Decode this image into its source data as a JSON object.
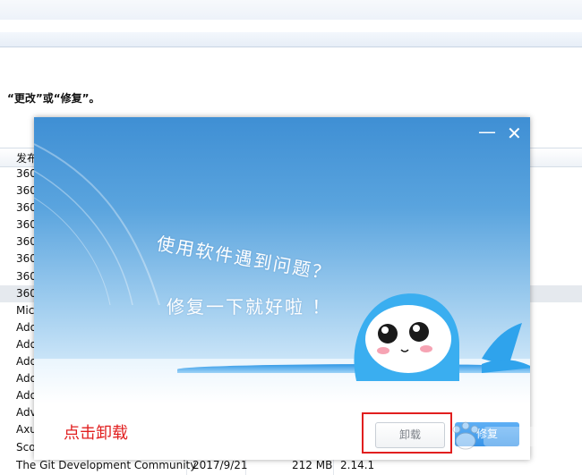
{
  "background": {
    "hint_text": "“更改”或“修复”。",
    "list_header_first_col": "发布",
    "rows": [
      {
        "publisher": "360"
      },
      {
        "publisher": "360"
      },
      {
        "publisher": "360"
      },
      {
        "publisher": "360"
      },
      {
        "publisher": "360"
      },
      {
        "publisher": "360"
      },
      {
        "publisher": "360"
      },
      {
        "publisher": "360",
        "selected": true
      },
      {
        "publisher": "Mic"
      },
      {
        "publisher": "Ado"
      },
      {
        "publisher": "Ado"
      },
      {
        "publisher": "Ado"
      },
      {
        "publisher": "Ado"
      },
      {
        "publisher": "Ado"
      },
      {
        "publisher": "Adv"
      },
      {
        "publisher": "Axu"
      },
      {
        "publisher": "Sco"
      }
    ],
    "last_row": {
      "publisher": "The Git Development Community",
      "installed": "2017/9/21",
      "size": "212 MB",
      "version": "2.14.1"
    }
  },
  "dialog": {
    "minimize_glyph": "—",
    "close_glyph": "✕",
    "slogan_line1": "使用软件遇到问题？",
    "slogan_line2": "修复一下就好啦 ！",
    "uninstall_label": "卸载",
    "repair_label": "修复"
  },
  "annotation": {
    "text": "点击卸载",
    "color": "#e11f1f"
  },
  "colors": {
    "sky_top": "#3f8fd4",
    "repair_blue": "#3894e8",
    "mascot_blue": "#2fa3ec"
  },
  "icons": [
    "minimize-icon",
    "close-icon",
    "mascot-illustration",
    "baidu-watermark"
  ]
}
